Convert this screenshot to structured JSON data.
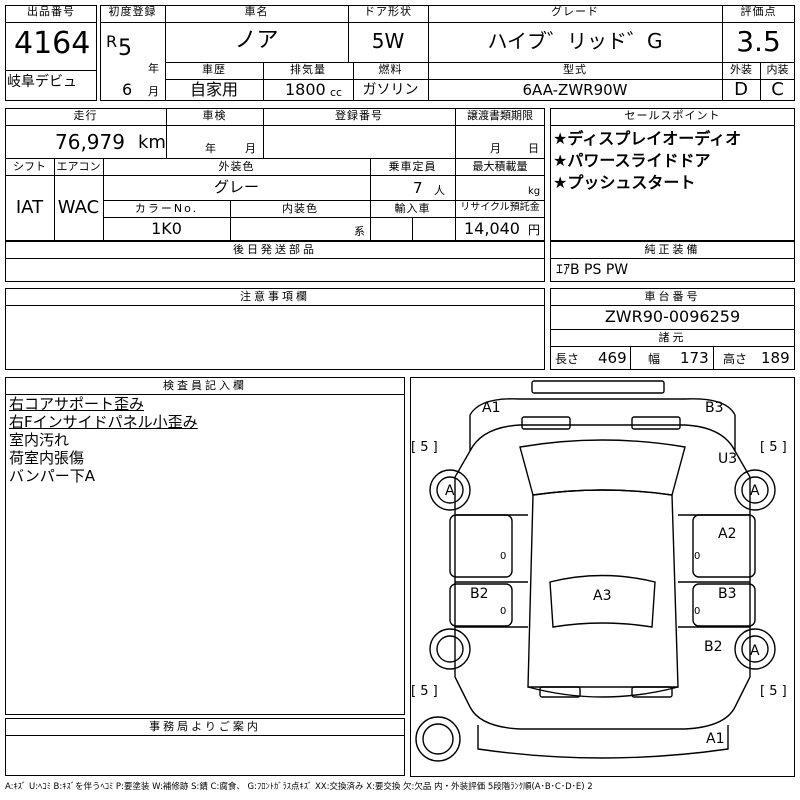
{
  "lot": {
    "header": "出品番号",
    "number": "4164",
    "venue": "岐阜デビュ"
  },
  "registration": {
    "header": "初度登録",
    "era": "R",
    "year": "5",
    "year_unit": "年",
    "month": "6",
    "month_unit": "月"
  },
  "car": {
    "name_header": "車名",
    "name": "ノア",
    "door_header": "ドア形状",
    "door": "5W",
    "grade_header": "グレード",
    "grade": "ハイブ゛リッド゛G",
    "score_header": "評価点",
    "score": "3.5",
    "history_header": "車歴",
    "history": "自家用",
    "displacement_header": "排気量",
    "displacement": "1800",
    "displacement_unit": "cc",
    "fuel_header": "燃料",
    "fuel": "ガソリン",
    "model_header": "型式",
    "model": "6AA-ZWR90W",
    "exterior_header": "外装",
    "exterior_grade": "D",
    "interior_header": "内装",
    "interior_grade": "C"
  },
  "mileage": {
    "header": "走行",
    "value": "76,979",
    "unit": "km"
  },
  "inspection": {
    "header": "車検",
    "year_unit": "年",
    "month_unit": "月"
  },
  "plate": {
    "header": "登録番号"
  },
  "transfer_doc": {
    "header": "譲渡書類期限",
    "month_unit": "月",
    "day_unit": "日"
  },
  "specs": {
    "shift_header": "シフト",
    "shift": "IAT",
    "ac_header": "エアコン",
    "ac": "WAC",
    "color_header": "外装色",
    "color": "グレー",
    "capacity_header": "乗車定員",
    "capacity": "7",
    "capacity_unit": "人",
    "load_header": "最大積載量",
    "load_unit": "kg",
    "color_no_header": "カラーNo.",
    "color_no": "1K0",
    "interior_color_header": "内装色",
    "interior_color_unit": "系",
    "import_header": "輸入車",
    "recycle_header": "リサイクル預託金",
    "recycle": "14,040",
    "recycle_unit": "円"
  },
  "sales_points": {
    "header": "セールスポイント",
    "items": [
      "★ディスプレイオーディオ",
      "★パワースライドドア",
      "★プッシュスタート"
    ]
  },
  "later_parts": {
    "header": "後日発送部品"
  },
  "equipment": {
    "header": "純正装備",
    "value": "ｴｱB PS PW"
  },
  "notes": {
    "header": "注意事項欄"
  },
  "chassis": {
    "header": "車台番号",
    "value": "ZWR90-0096259",
    "dims_header": "諸元",
    "length_label": "長さ",
    "length": "469",
    "width_label": "幅",
    "width": "173",
    "height_label": "高さ",
    "height": "189"
  },
  "inspector": {
    "header": "検査員記入欄",
    "lines": [
      "右コアサポート歪み",
      "右Fインサイドパネル小歪み",
      "室内汚れ",
      "荷室内張傷",
      "バンパー下A"
    ]
  },
  "office": {
    "header": "事務局よりご案内"
  },
  "diagram": {
    "labels": {
      "front_left": "A1",
      "front_right": "B3",
      "right_front_fender": "U3",
      "roof": "A3",
      "left_rear_door": "B2",
      "right_front_door": "A2",
      "right_rear_door": "B3",
      "right_rear_quarter": "B2",
      "rear_bumper": "A1"
    },
    "wheels": [
      "A",
      "A",
      "A"
    ],
    "tread": [
      "[ 5 ]",
      "[ 5 ]",
      "[ 5 ]",
      "[ 5 ]"
    ],
    "zeros": [
      "0",
      "0",
      "0",
      "0"
    ]
  },
  "legend": "A:ｷｽﾞ U:ﾍｺﾐ B:ｷｽﾞを伴うﾍｺﾐ P:要塗装 W:補修跡 S:錆 C:腐食、 G:ﾌﾛﾝﾄｶﾞﾗｽ点ｷｽﾞ XX:交換済み X:要交換 欠:欠品 内・外装評価 5段階ﾗﾝｸ順(A･B･C･D･E) 2"
}
